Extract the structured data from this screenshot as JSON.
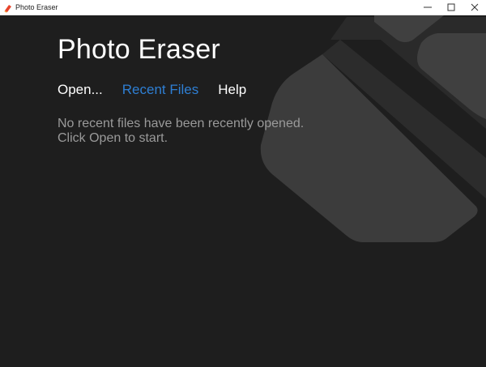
{
  "window": {
    "title": "Photo Eraser",
    "icon": "photo-eraser-app-icon",
    "controls": [
      "minimize-icon",
      "maximize-icon",
      "close-icon"
    ]
  },
  "app": {
    "title": "Photo Eraser"
  },
  "menu": {
    "open_label": "Open...",
    "recent_label": "Recent Files",
    "help_label": "Help",
    "active": "Recent Files"
  },
  "message": {
    "line1": "No recent files have been recently opened.",
    "line2": "Click Open to start."
  },
  "colors": {
    "background": "#1e1e1e",
    "accent": "#2e7fd4",
    "text": "#ffffff",
    "muted_text": "#9a9a9a",
    "decor_shape": "#3a3a3a"
  }
}
